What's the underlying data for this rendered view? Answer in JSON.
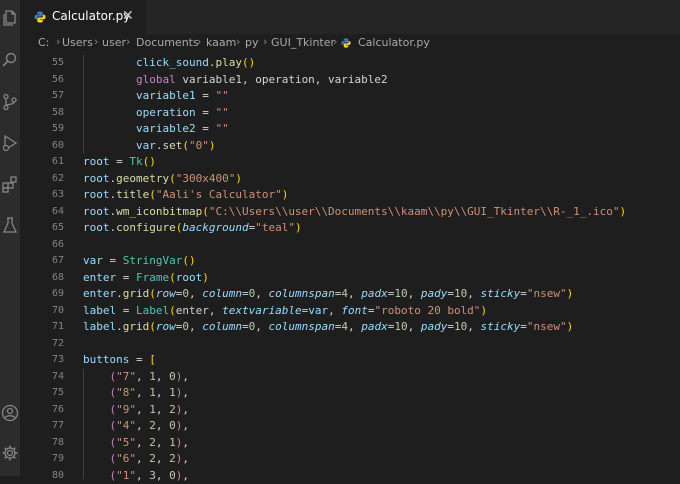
{
  "tab": {
    "label": "Calculator.py",
    "close": "✕",
    "icon": "python-file-icon"
  },
  "breadcrumb": [
    "C:",
    "Users",
    "user",
    "Documents",
    "kaam",
    "py",
    "GUI_Tkinter",
    "Calculator.py"
  ],
  "breadcrumb_separator": "›",
  "activity_bar": [
    "explorer-icon",
    "search-icon",
    "source-control-icon",
    "run-debug-icon",
    "extensions-icon",
    "testing-icon",
    "account-icon",
    "settings-gear-icon"
  ],
  "colors": {
    "background": "#1e1e1e",
    "activity_bar": "#2c2c2c",
    "tabbar": "#252526",
    "function": "#dcdcaa",
    "keyword": "#c586c0",
    "variable": "#9cdcfe",
    "string": "#ce9178",
    "number": "#b5cea8",
    "class": "#4ec9b0",
    "bracket": "#ffd700"
  },
  "line_numbers": [
    "55",
    "56",
    "57",
    "58",
    "59",
    "60",
    "61",
    "62",
    "63",
    "64",
    "65",
    "66",
    "67",
    "68",
    "69",
    "70",
    "71",
    "72",
    "73",
    "74",
    "75",
    "76",
    "77",
    "78",
    "79",
    "80"
  ],
  "code": [
    {
      "tokens": [
        [
          "        ",
          ""
        ],
        [
          "click_sound",
          "var"
        ],
        [
          ".",
          ""
        ],
        [
          "play",
          "fn"
        ],
        [
          "()",
          "par"
        ]
      ]
    },
    {
      "tokens": [
        [
          "        ",
          ""
        ],
        [
          "global",
          "kw"
        ],
        [
          " variable1, operation, variable2",
          ""
        ]
      ]
    },
    {
      "tokens": [
        [
          "        ",
          ""
        ],
        [
          "variable1",
          "var"
        ],
        [
          " = ",
          ""
        ],
        [
          "\"\"",
          "str"
        ]
      ]
    },
    {
      "tokens": [
        [
          "        ",
          ""
        ],
        [
          "operation",
          "var"
        ],
        [
          " = ",
          ""
        ],
        [
          "\"\"",
          "str"
        ]
      ]
    },
    {
      "tokens": [
        [
          "        ",
          ""
        ],
        [
          "variable2",
          "var"
        ],
        [
          " = ",
          ""
        ],
        [
          "\"\"",
          "str"
        ]
      ]
    },
    {
      "tokens": [
        [
          "        ",
          ""
        ],
        [
          "var",
          "var"
        ],
        [
          ".",
          ""
        ],
        [
          "set",
          "fn"
        ],
        [
          "(",
          "par"
        ],
        [
          "\"0\"",
          "str"
        ],
        [
          ")",
          "par"
        ]
      ]
    },
    {
      "tokens": [
        [
          "root",
          "var"
        ],
        [
          " = ",
          ""
        ],
        [
          "Tk",
          "cls"
        ],
        [
          "()",
          "par"
        ]
      ]
    },
    {
      "tokens": [
        [
          "root",
          "var"
        ],
        [
          ".",
          ""
        ],
        [
          "geometry",
          "fn"
        ],
        [
          "(",
          "par"
        ],
        [
          "\"300x400\"",
          "str"
        ],
        [
          ")",
          "par"
        ]
      ]
    },
    {
      "tokens": [
        [
          "root",
          "var"
        ],
        [
          ".",
          ""
        ],
        [
          "title",
          "fn"
        ],
        [
          "(",
          "par"
        ],
        [
          "\"Aali's Calculator\"",
          "str"
        ],
        [
          ")",
          "par"
        ]
      ]
    },
    {
      "tokens": [
        [
          "root",
          "var"
        ],
        [
          ".",
          ""
        ],
        [
          "wm_iconbitmap",
          "fn"
        ],
        [
          "(",
          "par"
        ],
        [
          "\"C:\\\\Users\\\\user\\\\Documents\\\\kaam\\\\py\\\\GUI_Tkinter\\\\R-_1_.ico\"",
          "str"
        ],
        [
          ")",
          "par"
        ]
      ]
    },
    {
      "tokens": [
        [
          "root",
          "var"
        ],
        [
          ".",
          ""
        ],
        [
          "configure",
          "fn"
        ],
        [
          "(",
          "par"
        ],
        [
          "background",
          "var it"
        ],
        [
          "=",
          ""
        ],
        [
          "\"teal\"",
          "str"
        ],
        [
          ")",
          "par"
        ]
      ]
    },
    {
      "tokens": []
    },
    {
      "tokens": [
        [
          "var",
          "var"
        ],
        [
          " = ",
          ""
        ],
        [
          "StringVar",
          "cls"
        ],
        [
          "()",
          "par"
        ]
      ]
    },
    {
      "tokens": [
        [
          "enter",
          "var"
        ],
        [
          " = ",
          ""
        ],
        [
          "Frame",
          "cls"
        ],
        [
          "(",
          "par"
        ],
        [
          "root",
          "var"
        ],
        [
          ")",
          "par"
        ]
      ]
    },
    {
      "tokens": [
        [
          "enter",
          "var"
        ],
        [
          ".",
          ""
        ],
        [
          "grid",
          "fn"
        ],
        [
          "(",
          "par"
        ],
        [
          "row",
          "var it"
        ],
        [
          "=",
          ""
        ],
        [
          "0",
          "num"
        ],
        [
          ", ",
          ""
        ],
        [
          "column",
          "var it"
        ],
        [
          "=",
          ""
        ],
        [
          "0",
          "num"
        ],
        [
          ", ",
          ""
        ],
        [
          "columnspan",
          "var it"
        ],
        [
          "=",
          ""
        ],
        [
          "4",
          "num"
        ],
        [
          ", ",
          ""
        ],
        [
          "padx",
          "var it"
        ],
        [
          "=",
          ""
        ],
        [
          "10",
          "num"
        ],
        [
          ", ",
          ""
        ],
        [
          "pady",
          "var it"
        ],
        [
          "=",
          ""
        ],
        [
          "10",
          "num"
        ],
        [
          ", ",
          ""
        ],
        [
          "sticky",
          "var it"
        ],
        [
          "=",
          ""
        ],
        [
          "\"nsew\"",
          "str"
        ],
        [
          ")",
          "par"
        ]
      ]
    },
    {
      "tokens": [
        [
          "label",
          "var"
        ],
        [
          " = ",
          ""
        ],
        [
          "Label",
          "cls"
        ],
        [
          "(",
          "par"
        ],
        [
          "enter, ",
          ""
        ],
        [
          "textvariable",
          "var it"
        ],
        [
          "=",
          ""
        ],
        [
          "var",
          "var"
        ],
        [
          ", ",
          ""
        ],
        [
          "font",
          "var it"
        ],
        [
          "=",
          ""
        ],
        [
          "\"roboto 20 bold\"",
          "str"
        ],
        [
          ")",
          "par"
        ]
      ]
    },
    {
      "tokens": [
        [
          "label",
          "var"
        ],
        [
          ".",
          ""
        ],
        [
          "grid",
          "fn"
        ],
        [
          "(",
          "par"
        ],
        [
          "row",
          "var it"
        ],
        [
          "=",
          ""
        ],
        [
          "0",
          "num"
        ],
        [
          ", ",
          ""
        ],
        [
          "column",
          "var it"
        ],
        [
          "=",
          ""
        ],
        [
          "0",
          "num"
        ],
        [
          ", ",
          ""
        ],
        [
          "columnspan",
          "var it"
        ],
        [
          "=",
          ""
        ],
        [
          "4",
          "num"
        ],
        [
          ", ",
          ""
        ],
        [
          "padx",
          "var it"
        ],
        [
          "=",
          ""
        ],
        [
          "10",
          "num"
        ],
        [
          ", ",
          ""
        ],
        [
          "pady",
          "var it"
        ],
        [
          "=",
          ""
        ],
        [
          "10",
          "num"
        ],
        [
          ", ",
          ""
        ],
        [
          "sticky",
          "var it"
        ],
        [
          "=",
          ""
        ],
        [
          "\"nsew\"",
          "str"
        ],
        [
          ")",
          "par"
        ]
      ]
    },
    {
      "tokens": []
    },
    {
      "tokens": [
        [
          "buttons",
          "var"
        ],
        [
          " = ",
          ""
        ],
        [
          "[",
          "par"
        ]
      ]
    },
    {
      "tokens": [
        [
          "    ",
          ""
        ],
        [
          "(",
          "kw"
        ],
        [
          "\"7\"",
          "str"
        ],
        [
          ", ",
          ""
        ],
        [
          "1",
          "num"
        ],
        [
          ", ",
          ""
        ],
        [
          "0",
          "num"
        ],
        [
          ")",
          "kw"
        ],
        [
          ",",
          ""
        ]
      ]
    },
    {
      "tokens": [
        [
          "    ",
          ""
        ],
        [
          "(",
          "kw"
        ],
        [
          "\"8\"",
          "str"
        ],
        [
          ", ",
          ""
        ],
        [
          "1",
          "num"
        ],
        [
          ", ",
          ""
        ],
        [
          "1",
          "num"
        ],
        [
          ")",
          "kw"
        ],
        [
          ",",
          ""
        ]
      ]
    },
    {
      "tokens": [
        [
          "    ",
          ""
        ],
        [
          "(",
          "kw"
        ],
        [
          "\"9\"",
          "str"
        ],
        [
          ", ",
          ""
        ],
        [
          "1",
          "num"
        ],
        [
          ", ",
          ""
        ],
        [
          "2",
          "num"
        ],
        [
          ")",
          "kw"
        ],
        [
          ",",
          ""
        ]
      ]
    },
    {
      "tokens": [
        [
          "    ",
          ""
        ],
        [
          "(",
          "kw"
        ],
        [
          "\"4\"",
          "str"
        ],
        [
          ", ",
          ""
        ],
        [
          "2",
          "num"
        ],
        [
          ", ",
          ""
        ],
        [
          "0",
          "num"
        ],
        [
          ")",
          "kw"
        ],
        [
          ",",
          ""
        ]
      ]
    },
    {
      "tokens": [
        [
          "    ",
          ""
        ],
        [
          "(",
          "kw"
        ],
        [
          "\"5\"",
          "str"
        ],
        [
          ", ",
          ""
        ],
        [
          "2",
          "num"
        ],
        [
          ", ",
          ""
        ],
        [
          "1",
          "num"
        ],
        [
          ")",
          "kw"
        ],
        [
          ",",
          ""
        ]
      ]
    },
    {
      "tokens": [
        [
          "    ",
          ""
        ],
        [
          "(",
          "kw"
        ],
        [
          "\"6\"",
          "str"
        ],
        [
          ", ",
          ""
        ],
        [
          "2",
          "num"
        ],
        [
          ", ",
          ""
        ],
        [
          "2",
          "num"
        ],
        [
          ")",
          "kw"
        ],
        [
          ",",
          ""
        ]
      ]
    },
    {
      "tokens": [
        [
          "    ",
          ""
        ],
        [
          "(",
          "kw"
        ],
        [
          "\"1\"",
          "str"
        ],
        [
          ", ",
          ""
        ],
        [
          "3",
          "num"
        ],
        [
          ", ",
          ""
        ],
        [
          "0",
          "num"
        ],
        [
          ")",
          "kw"
        ],
        [
          ",",
          ""
        ]
      ]
    }
  ]
}
